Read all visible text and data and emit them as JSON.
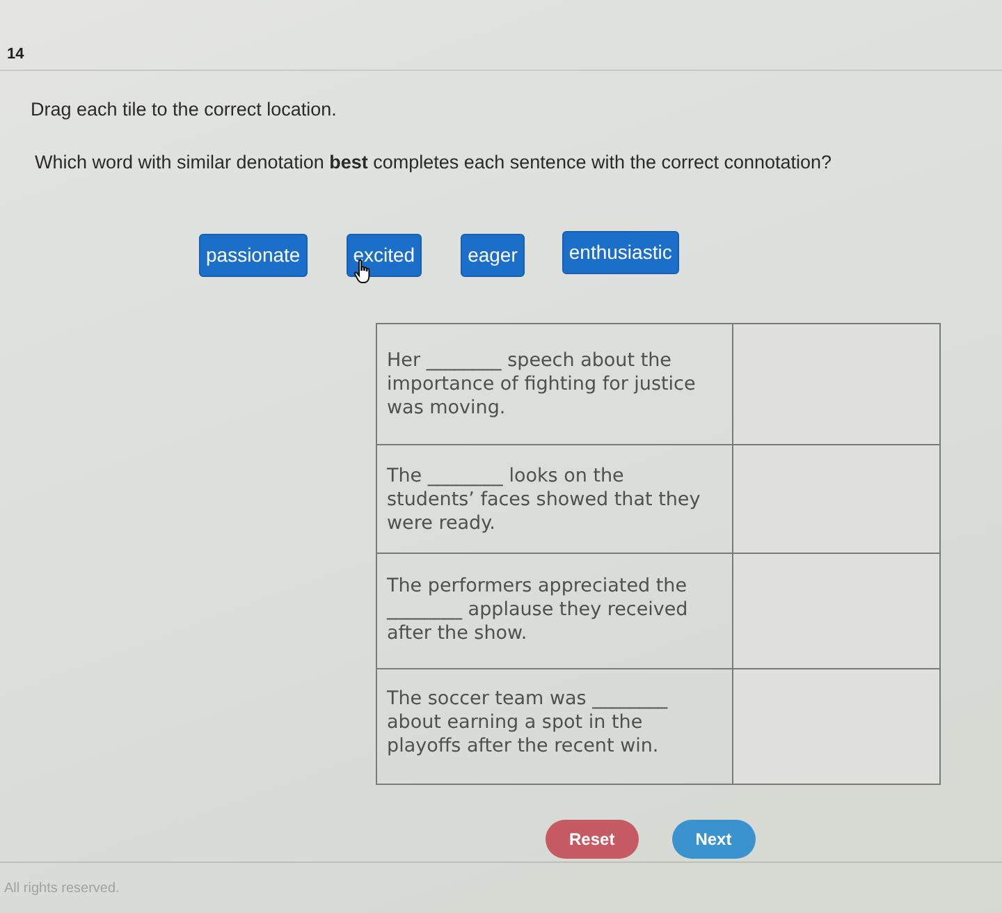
{
  "question_number": "14",
  "instruction": "Drag each tile to the correct location.",
  "question": "Which word with similar denotation **best** completes each sentence with the correct connotation?",
  "tiles": [
    {
      "label": "passionate",
      "hovered": false
    },
    {
      "label": "excited",
      "hovered": true
    },
    {
      "label": "eager",
      "hovered": false
    },
    {
      "label": "enthusiastic",
      "hovered": false
    }
  ],
  "table": {
    "rows": [
      {
        "sentence": "Her ________ speech about the importance of fighting for justice was moving."
      },
      {
        "sentence": "The ________ looks on the students’ faces showed that they were ready."
      },
      {
        "sentence": "The performers appreciated the ________ applause they received after the show."
      },
      {
        "sentence": "The soccer team was ________ about earning a spot in the playoffs after the recent win."
      }
    ]
  },
  "buttons": [
    {
      "label": "Reset",
      "kind": "reset"
    },
    {
      "label": "Next",
      "kind": "next"
    }
  ],
  "footer": "All rights reserved."
}
